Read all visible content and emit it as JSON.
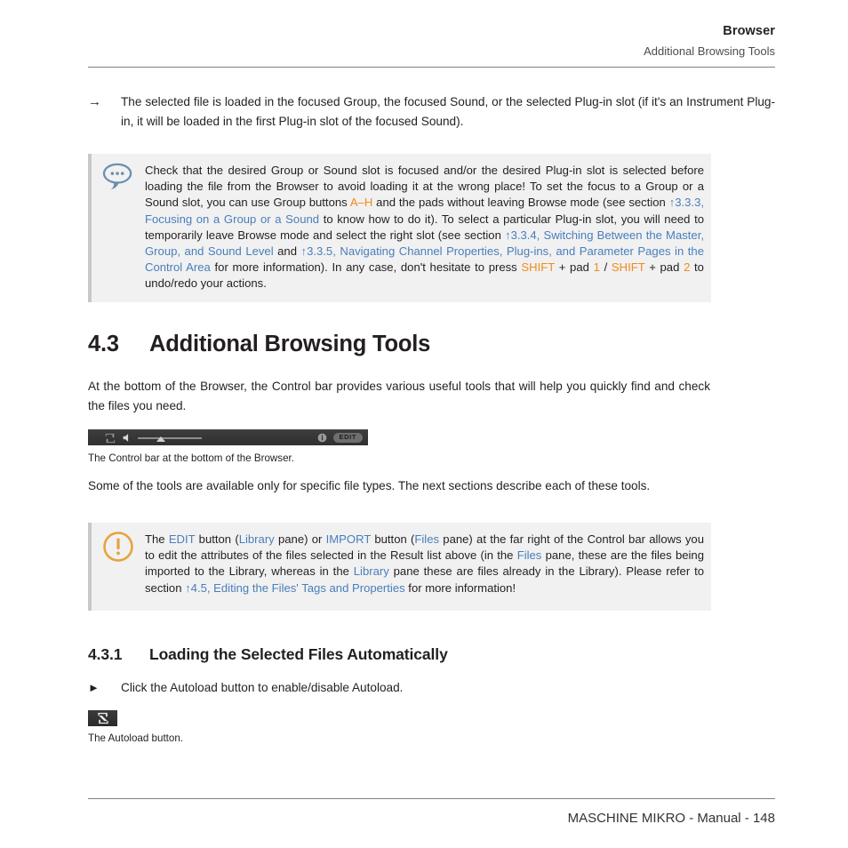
{
  "header": {
    "title": "Browser",
    "subtitle": "Additional Browsing Tools"
  },
  "arrow_note": {
    "marker": "→",
    "text": "The selected file is loaded in the focused Group, the focused Sound, or the selected Plug-in slot (if it's an Instrument Plug-in, it will be loaded in the first Plug-in slot of the focused Sound)."
  },
  "tip_callout": {
    "icon": "speech-bubble-icon",
    "accent_color": "#5b84a8",
    "background": "#f1f1f1",
    "segments": [
      {
        "t": "Check that the desired Group or Sound slot is focused and/or the desired Plug-in slot is selected before loading the file from the Browser to avoid loading it at the wrong place! To set the focus to a Group or a Sound slot, you can use Group buttons ",
        "s": "normal"
      },
      {
        "t": "A",
        "s": "orange"
      },
      {
        "t": "–",
        "s": "orange"
      },
      {
        "t": "H",
        "s": "orange"
      },
      {
        "t": " and the pads without leaving Browse mode (see section ",
        "s": "normal"
      },
      {
        "t": "↑3.3.3, Focusing on a Group or a Sound",
        "s": "link"
      },
      {
        "t": " to know how to do it). To select a particular Plug-in slot, you will need to temporarily leave Browse mode and select the right slot (see section ",
        "s": "normal"
      },
      {
        "t": "↑3.3.4, Switching Between the Master, Group, and Sound Level",
        "s": "link"
      },
      {
        "t": " and ",
        "s": "normal"
      },
      {
        "t": "↑3.3.5, Navigating Channel Properties, Plug-ins, and Parameter Pages in the Control Area",
        "s": "link"
      },
      {
        "t": " for more information). In any case, don't hesitate to press ",
        "s": "normal"
      },
      {
        "t": "SHIFT",
        "s": "orange"
      },
      {
        "t": " + pad ",
        "s": "normal"
      },
      {
        "t": "1",
        "s": "orange"
      },
      {
        "t": " / ",
        "s": "normal"
      },
      {
        "t": "SHIFT",
        "s": "orange"
      },
      {
        "t": " + pad ",
        "s": "normal"
      },
      {
        "t": "2",
        "s": "orange"
      },
      {
        "t": " to undo/redo your actions.",
        "s": "normal"
      }
    ]
  },
  "section": {
    "number": "4.3",
    "title": "Additional Browsing Tools"
  },
  "paragraph_1": "At the bottom of the Browser, the Control bar provides various useful tools that will help you quickly find and check the files you need.",
  "paragraph_2": "Some of the tools are available only for specific file types. The next sections describe each of these tools.",
  "control_bar_figure": {
    "caption": "The Control bar at the bottom of the Browser.",
    "autoload_icon": "autoload-loop-icon",
    "speaker_icon": "speaker-icon",
    "info_icon": "info-icon",
    "edit_button_label": "EDIT",
    "slider_value": 29
  },
  "warning_callout": {
    "icon": "warning-exclamation-icon",
    "accent_color": "#e8a33d",
    "background": "#f1f1f1",
    "segments": [
      {
        "t": "The ",
        "s": "normal"
      },
      {
        "t": "EDIT",
        "s": "link"
      },
      {
        "t": " button (",
        "s": "normal"
      },
      {
        "t": "Library",
        "s": "link"
      },
      {
        "t": " pane) or ",
        "s": "normal"
      },
      {
        "t": "IMPORT",
        "s": "link"
      },
      {
        "t": " button (",
        "s": "normal"
      },
      {
        "t": "Files",
        "s": "link"
      },
      {
        "t": " pane) at the far right of the Control bar allows you to edit the attributes of the files selected in the Result list above (in the ",
        "s": "normal"
      },
      {
        "t": "Files",
        "s": "link"
      },
      {
        "t": " pane, these are the files being imported to the Library, whereas in the ",
        "s": "normal"
      },
      {
        "t": "Library",
        "s": "link"
      },
      {
        "t": " pane these are files already in the Library). Please refer to section ",
        "s": "normal"
      },
      {
        "t": "↑4.5, Editing the Files' Tags and Properties",
        "s": "link"
      },
      {
        "t": " for more information!",
        "s": "normal"
      }
    ]
  },
  "subsection": {
    "number": "4.3.1",
    "title": "Loading the Selected Files Automatically"
  },
  "bullet_note": {
    "marker": "►",
    "text": "Click the Autoload button to enable/disable Autoload."
  },
  "autoload_figure": {
    "caption": "The Autoload button.",
    "icon": "autoload-loop-icon"
  },
  "footer": {
    "text": "MASCHINE MIKRO - Manual - 148"
  },
  "colors": {
    "link": "#4a7ebb",
    "orange": "#f08a1e",
    "rule": "#808080",
    "callout_bg": "#f1f1f1",
    "callout_border": "#c8c8c8"
  }
}
